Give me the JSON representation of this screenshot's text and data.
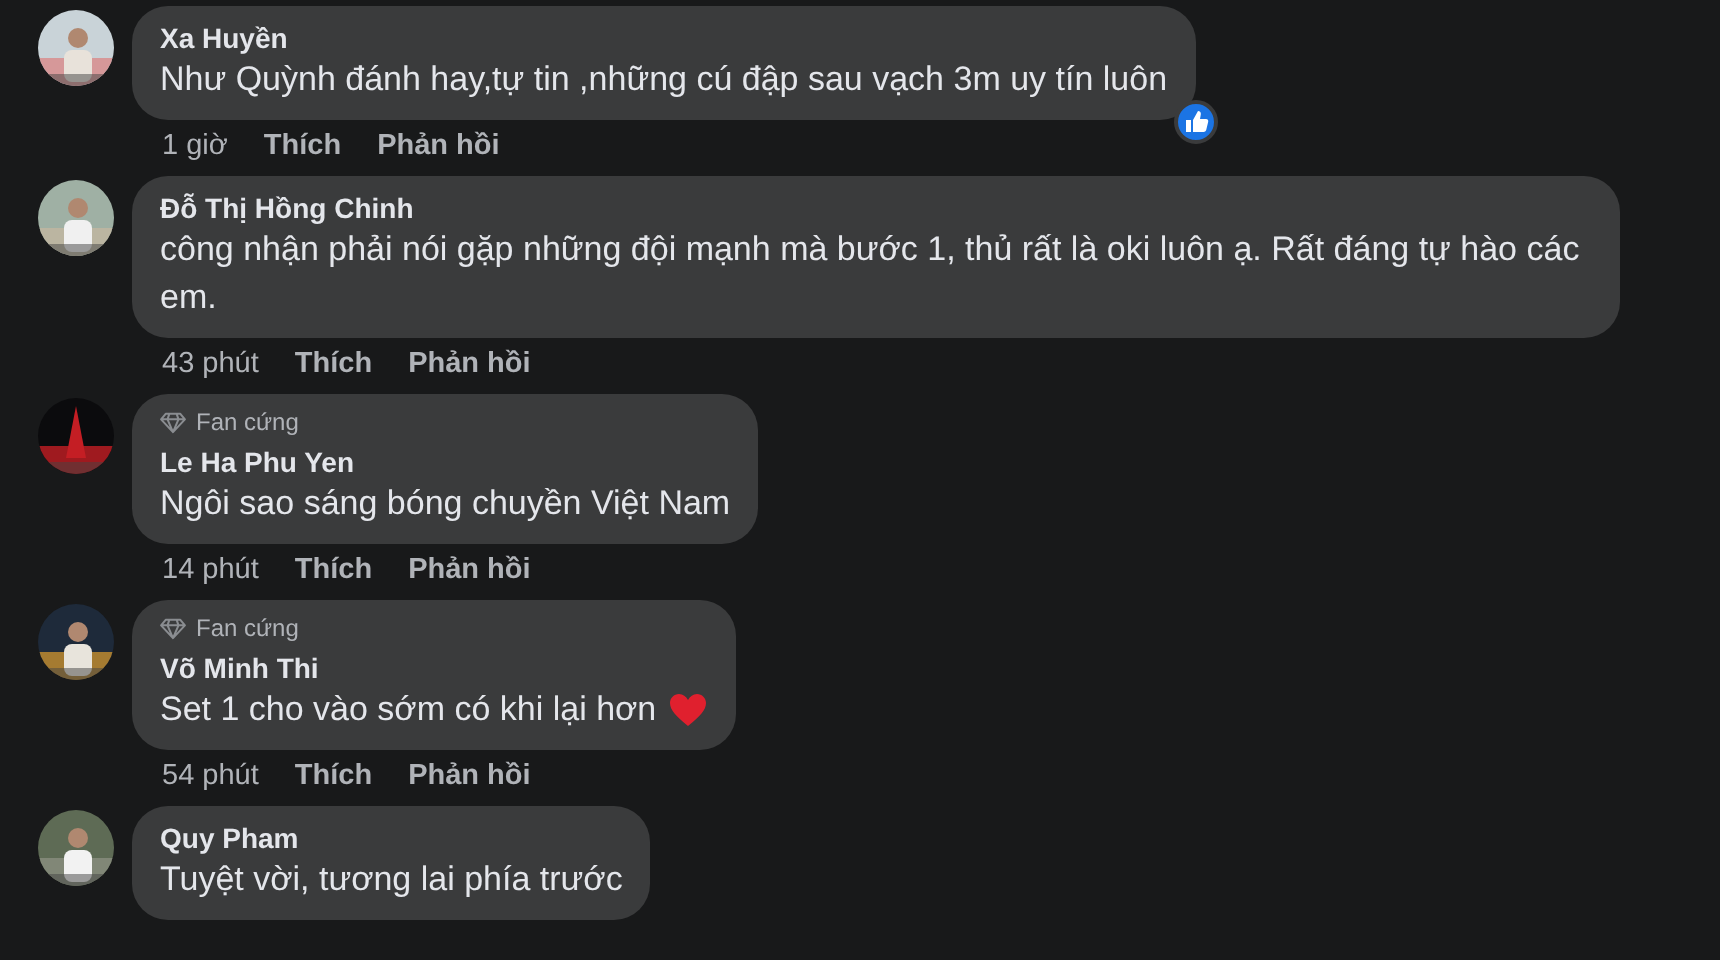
{
  "comments": [
    {
      "author": "Xa Huyền",
      "text": "Như Quỳnh đánh hay,tự tin ,những cú đập sau vạch 3m uy tín luôn",
      "heart": false,
      "liked": true,
      "time": "1 giờ",
      "like_label": "Thích",
      "reply_label": "Phản hồi"
    },
    {
      "author": "Đỗ Thị Hồng Chinh",
      "text": "công nhận phải nói gặp những đội mạnh mà bước 1, thủ rất là oki luôn ạ. Rất đáng tự hào các em.",
      "heart": false,
      "liked": false,
      "time": "43 phút",
      "like_label": "Thích",
      "reply_label": "Phản hồi"
    },
    {
      "author": "Le Ha Phu Yen",
      "badge": "Fan cứng",
      "text": "Ngôi sao sáng bóng chuyền Việt Nam",
      "heart": false,
      "liked": false,
      "time": "14 phút",
      "like_label": "Thích",
      "reply_label": "Phản hồi"
    },
    {
      "author": "Võ Minh Thi",
      "badge": "Fan cứng",
      "text": "Set 1 cho vào sớm có khi lại hơn",
      "heart": true,
      "liked": false,
      "time": "54 phút",
      "like_label": "Thích",
      "reply_label": "Phản hồi"
    },
    {
      "author": "Quy Pham",
      "text": "Tuyệt vời, tương lai phía trước",
      "heart": false,
      "liked": false
    }
  ]
}
